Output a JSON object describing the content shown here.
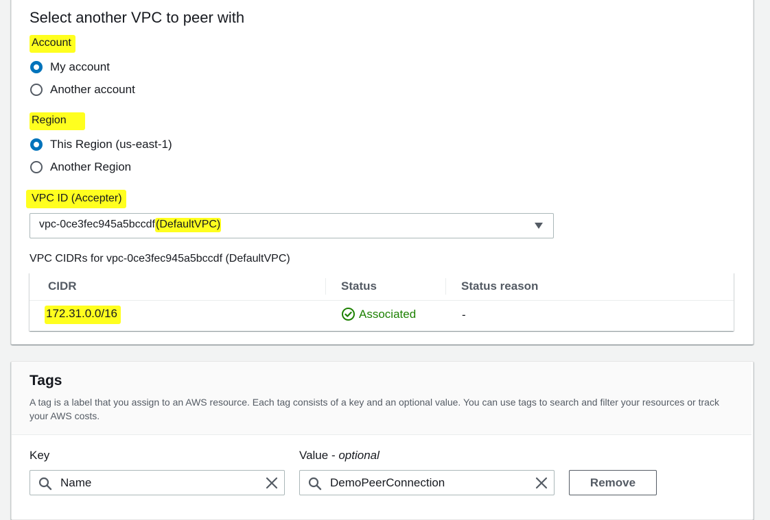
{
  "vpc_section": {
    "title": "Select another VPC to peer with",
    "account": {
      "label": "Account",
      "options": [
        {
          "label": "My account",
          "selected": true
        },
        {
          "label": "Another account",
          "selected": false
        }
      ]
    },
    "region": {
      "label": "Region",
      "options": [
        {
          "label": "This Region (us-east-1)",
          "selected": true
        },
        {
          "label": "Another Region",
          "selected": false
        }
      ]
    },
    "vpc_id": {
      "label": "VPC ID (Accepter)",
      "selected_id": "vpc-0ce3fec945a5bccdf",
      "selected_name": "(DefaultVPC)"
    },
    "cidr_caption": "VPC CIDRs for vpc-0ce3fec945a5bccdf (DefaultVPC)",
    "cidr_table": {
      "headers": [
        "CIDR",
        "Status",
        "Status reason"
      ],
      "rows": [
        {
          "cidr": "172.31.0.0/16",
          "status": "Associated",
          "status_icon": "check-circle-icon",
          "reason": "-"
        }
      ]
    }
  },
  "tags_section": {
    "title": "Tags",
    "description": "A tag is a label that you assign to an AWS resource. Each tag consists of a key and an optional value. You can use tags to search and filter your resources or track your AWS costs.",
    "key_label": "Key",
    "value_label": "Value - ",
    "value_label_optional": "optional",
    "rows": [
      {
        "key": "Name",
        "value": "DemoPeerConnection",
        "remove_label": "Remove"
      }
    ]
  },
  "colors": {
    "highlight": "#ffff1f",
    "radio_selected": "#0073bb",
    "status_ok": "#1d8102",
    "page_bg": "#f2f3f3"
  }
}
